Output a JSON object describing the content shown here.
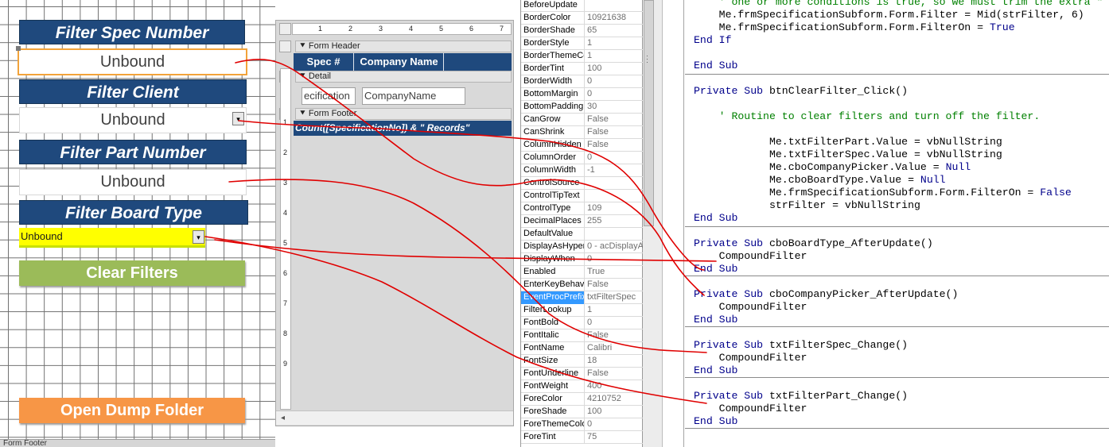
{
  "filters": {
    "spec_title": "Filter Spec Number",
    "spec_value": "Unbound",
    "client_title": "Filter Client",
    "client_value": "Unbound",
    "part_title": "Filter Part Number",
    "part_value": "Unbound",
    "board_title": "Filter Board Type",
    "board_value": "Unbound",
    "clear_label": "Clear Filters",
    "open_dump_label": "Open Dump Folder",
    "form_footer_label": "Form Footer"
  },
  "colors": {
    "header_blue": "#1f497d",
    "clear_green": "#9bbb59",
    "dump_orange": "#f79646",
    "selected_yellow": "#ffff00",
    "annotation_red": "#e00000"
  },
  "subform": {
    "ruler": [
      "1",
      "2",
      "3",
      "4",
      "5",
      "6",
      "7"
    ],
    "vruler": [
      "1",
      "2",
      "3",
      "4",
      "5",
      "6",
      "7",
      "8",
      "9"
    ],
    "form_header": "Form Header",
    "detail": "Detail",
    "form_footer": "Form Footer",
    "col_spec": "Spec #",
    "col_company": "Company Name",
    "detail_spec": "ecification",
    "detail_company": "CompanyName",
    "footer_expr": "Count([SpecificationNo]) & \" Records\""
  },
  "properties": [
    {
      "name": "BeforeUpdate",
      "value": ""
    },
    {
      "name": "BorderColor",
      "value": "10921638"
    },
    {
      "name": "BorderShade",
      "value": "65"
    },
    {
      "name": "BorderStyle",
      "value": "1"
    },
    {
      "name": "BorderThemeCo",
      "value": "1"
    },
    {
      "name": "BorderTint",
      "value": "100"
    },
    {
      "name": "BorderWidth",
      "value": "0"
    },
    {
      "name": "BottomMargin",
      "value": "0"
    },
    {
      "name": "BottomPadding",
      "value": "30"
    },
    {
      "name": "CanGrow",
      "value": "False"
    },
    {
      "name": "CanShrink",
      "value": "False"
    },
    {
      "name": "ColumnHidden",
      "value": "False"
    },
    {
      "name": "ColumnOrder",
      "value": "0"
    },
    {
      "name": "ColumnWidth",
      "value": "-1"
    },
    {
      "name": "ControlSource",
      "value": ""
    },
    {
      "name": "ControlTipText",
      "value": ""
    },
    {
      "name": "ControlType",
      "value": "109"
    },
    {
      "name": "DecimalPlaces",
      "value": "255"
    },
    {
      "name": "DefaultValue",
      "value": ""
    },
    {
      "name": "DisplayAsHyperl",
      "value": "0 - acDisplayAs"
    },
    {
      "name": "DisplayWhen",
      "value": "0"
    },
    {
      "name": "Enabled",
      "value": "True"
    },
    {
      "name": "EnterKeyBehavi",
      "value": "False"
    },
    {
      "name": "EventProcPrefix",
      "value": "txtFilterSpec"
    },
    {
      "name": "FilterLookup",
      "value": "1"
    },
    {
      "name": "FontBold",
      "value": "0"
    },
    {
      "name": "FontItalic",
      "value": "False"
    },
    {
      "name": "FontName",
      "value": "Calibri"
    },
    {
      "name": "FontSize",
      "value": "18"
    },
    {
      "name": "FontUnderline",
      "value": "False"
    },
    {
      "name": "FontWeight",
      "value": "400"
    },
    {
      "name": "ForeColor",
      "value": "4210752"
    },
    {
      "name": "ForeShade",
      "value": "100"
    },
    {
      "name": "ForeThemeColor",
      "value": "0"
    },
    {
      "name": "ForeTint",
      "value": "75"
    }
  ],
  "code": {
    "l01": "    ' one or more conditions is true, so we must trim the extra \"",
    "l02": "    Me.frmSpecificationSubform.Form.Filter = Mid(strFilter, 6)",
    "l03": "    Me.frmSpecificationSubform.Form.FilterOn = ",
    "l03b": "True",
    "l04": "End If",
    "l05": "End Sub",
    "l06a": "Private Sub ",
    "l06b": "btnClearFilter_Click()",
    "l07": "    ' Routine to clear filters and turn off the filter.",
    "l08": "            Me.txtFilterPart.Value = vbNullString",
    "l09": "            Me.txtFilterSpec.Value = vbNullString",
    "l10a": "            Me.cboCompanyPicker.Value = ",
    "l10b": "Null",
    "l11a": "            Me.cboBoardType.Value = ",
    "l11b": "Null",
    "l12a": "            Me.frmSpecificationSubform.Form.FilterOn = ",
    "l12b": "False",
    "l13": "            strFilter = vbNullString",
    "l14": "End Sub",
    "l15a": "Private Sub ",
    "l15b": "cboBoardType_AfterUpdate()",
    "l16": "    CompoundFilter",
    "l17": "End Sub",
    "l18a": "Private Sub ",
    "l18b": "cboCompanyPicker_AfterUpdate()",
    "l19": "    CompoundFilter",
    "l20": "End Sub",
    "l21a": "Private Sub ",
    "l21b": "txtFilterSpec_Change()",
    "l22": "    CompoundFilter",
    "l23": "End Sub",
    "l24a": "Private Sub ",
    "l24b": "txtFilterPart_Change()",
    "l25": "    CompoundFilter",
    "l26": "End Sub"
  }
}
